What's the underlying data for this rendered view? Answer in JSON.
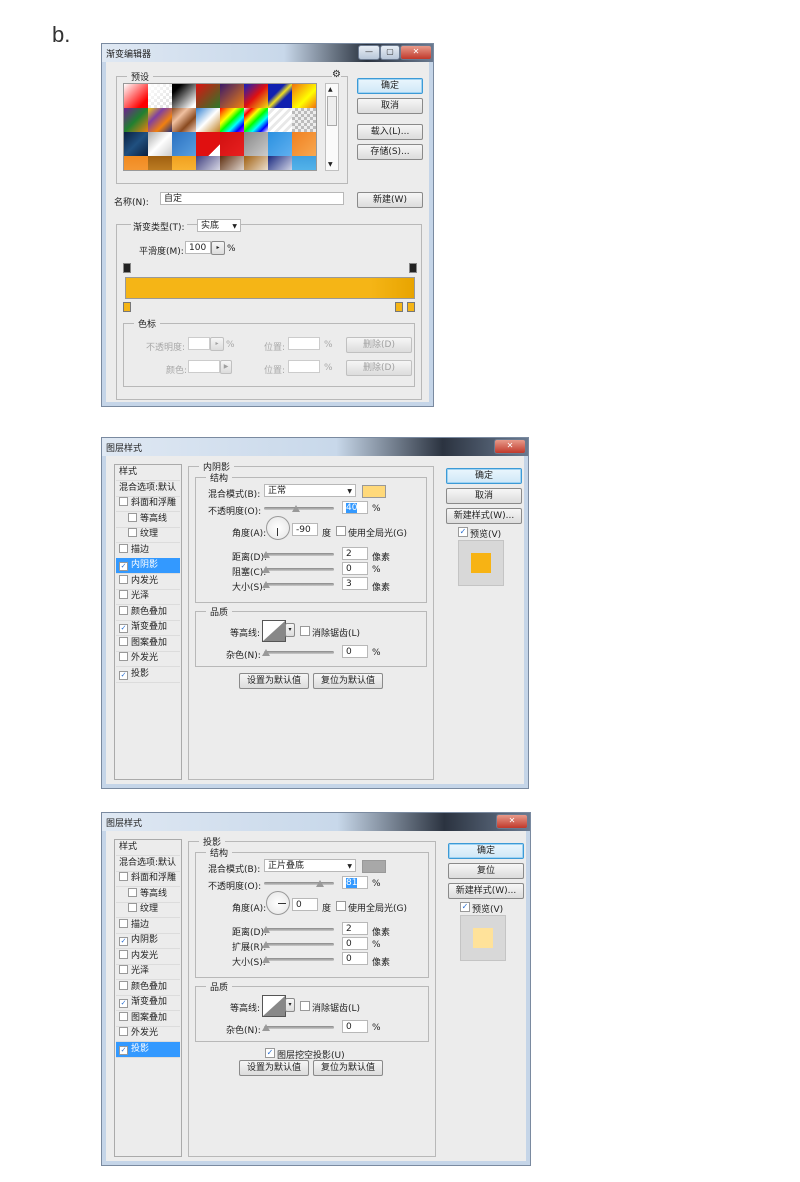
{
  "figure_label": "b.",
  "gradient_editor": {
    "title": "渐变编辑器",
    "presets_label": "预设",
    "gear_icon": "gear-icon",
    "buttons": {
      "ok": "确定",
      "cancel": "取消",
      "load": "载入(L)...",
      "save": "存储(S)...",
      "new": "新建(W)"
    },
    "name_label": "名称(N):",
    "name_value": "自定",
    "gradient_type_label": "渐变类型(T):",
    "gradient_type_value": "实底",
    "smoothness_label": "平滑度(M):",
    "smoothness_value": "100",
    "percent": "%",
    "gradient_color": "#f5b516",
    "stops_group_label": "色标",
    "opacity_label": "不透明度:",
    "color_label": "颜色:",
    "location_label": "位置:",
    "delete_label": "删除(D)"
  },
  "layer_style_inner_shadow": {
    "title": "图层样式",
    "list": [
      {
        "label": "样式",
        "type": "header"
      },
      {
        "label": "混合选项:默认",
        "type": "header"
      },
      {
        "label": "斜面和浮雕",
        "checked": false
      },
      {
        "label": "等高线",
        "checked": false,
        "indent": true
      },
      {
        "label": "纹理",
        "checked": false,
        "indent": true
      },
      {
        "label": "描边",
        "checked": false
      },
      {
        "label": "内阴影",
        "checked": true,
        "selected": true
      },
      {
        "label": "内发光",
        "checked": false
      },
      {
        "label": "光泽",
        "checked": false
      },
      {
        "label": "颜色叠加",
        "checked": false
      },
      {
        "label": "渐变叠加",
        "checked": true
      },
      {
        "label": "图案叠加",
        "checked": false
      },
      {
        "label": "外发光",
        "checked": false
      },
      {
        "label": "投影",
        "checked": true
      }
    ],
    "section_title": "内阴影",
    "structure_label": "结构",
    "blend_mode_label": "混合模式(B):",
    "blend_mode_value": "正常",
    "blend_color": "#ffd97a",
    "opacity_label": "不透明度(O):",
    "opacity_value": "40",
    "angle_label": "角度(A):",
    "angle_value": "-90",
    "degree": "度",
    "global_light_label": "使用全局光(G)",
    "distance_label": "距离(D):",
    "distance_value": "2",
    "choke_label": "阻塞(C):",
    "choke_value": "0",
    "size_label": "大小(S):",
    "size_value": "3",
    "px_unit": "像素",
    "percent": "%",
    "quality_label": "品质",
    "contour_label": "等高线:",
    "antialias_label": "消除锯齿(L)",
    "noise_label": "杂色(N):",
    "noise_value": "0",
    "set_default": "设置为默认值",
    "reset_default": "复位为默认值",
    "ok": "确定",
    "cancel": "取消",
    "new_style": "新建样式(W)...",
    "preview_label": "预览(V)",
    "preview_color": "#f7b314"
  },
  "layer_style_drop_shadow": {
    "title": "图层样式",
    "list": [
      {
        "label": "样式",
        "type": "header"
      },
      {
        "label": "混合选项:默认",
        "type": "header"
      },
      {
        "label": "斜面和浮雕",
        "checked": false
      },
      {
        "label": "等高线",
        "checked": false,
        "indent": true
      },
      {
        "label": "纹理",
        "checked": false,
        "indent": true
      },
      {
        "label": "描边",
        "checked": false
      },
      {
        "label": "内阴影",
        "checked": true
      },
      {
        "label": "内发光",
        "checked": false
      },
      {
        "label": "光泽",
        "checked": false
      },
      {
        "label": "颜色叠加",
        "checked": false
      },
      {
        "label": "渐变叠加",
        "checked": true
      },
      {
        "label": "图案叠加",
        "checked": false
      },
      {
        "label": "外发光",
        "checked": false
      },
      {
        "label": "投影",
        "checked": true,
        "selected": true
      }
    ],
    "section_title": "投影",
    "structure_label": "结构",
    "blend_mode_label": "混合模式(B):",
    "blend_mode_value": "正片叠底",
    "blend_color": "#a8a8a8",
    "opacity_label": "不透明度(O):",
    "opacity_value": "81",
    "angle_label": "角度(A):",
    "angle_value": "0",
    "degree": "度",
    "global_light_label": "使用全局光(G)",
    "distance_label": "距离(D):",
    "distance_value": "2",
    "spread_label": "扩展(R):",
    "spread_value": "0",
    "size_label": "大小(S):",
    "size_value": "0",
    "px_unit": "像素",
    "percent": "%",
    "quality_label": "品质",
    "contour_label": "等高线:",
    "antialias_label": "消除锯齿(L)",
    "noise_label": "杂色(N):",
    "noise_value": "0",
    "knockout_label": "图层挖空投影(U)",
    "set_default": "设置为默认值",
    "reset_default": "复位为默认值",
    "ok": "确定",
    "reset": "复位",
    "new_style": "新建样式(W)...",
    "preview_label": "预览(V)",
    "preview_color": "#ffe29a"
  }
}
